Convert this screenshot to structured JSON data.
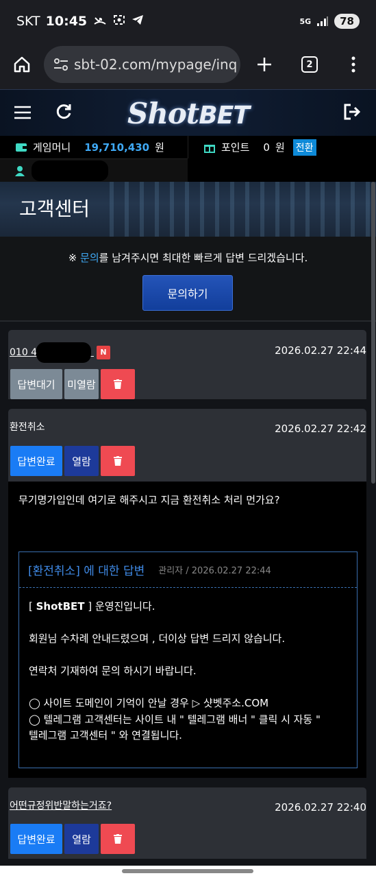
{
  "status_bar": {
    "carrier": "SKT",
    "time": "10:45",
    "icons": [
      "missed-call-icon",
      "screenshot-icon",
      "telegram-icon"
    ],
    "right_icons": [
      "5g-icon",
      "signal-icon"
    ],
    "battery": "78"
  },
  "browser": {
    "url": "sbt-02.com/mypage/inq",
    "tab_count": "2"
  },
  "site": {
    "logo_shot": "Shot",
    "logo_bet": "BET"
  },
  "account": {
    "money_label": "게임머니",
    "money_value": "19,710,430",
    "money_unit": "원",
    "point_label": "포인트",
    "point_value": "0",
    "point_unit": "원",
    "convert_label": "전환"
  },
  "banner": {
    "title": "고객센터"
  },
  "notice": {
    "prefix": "※ ",
    "highlight": "문의",
    "suffix": "를 남겨주시면 최대한 빠르게 답변 드리겠습니다.",
    "ask_button": "문의하기"
  },
  "inquiries": [
    {
      "subject": "010 4",
      "badge": "N",
      "date": "2026.02.27 22:44",
      "status": "답변대기",
      "read": "미열람"
    },
    {
      "subject": "환전취소",
      "date": "2026.02.27 22:42",
      "status": "답변완료",
      "read": "열람",
      "question": "무기명가입인데 여기로 해주시고 지금 환전취소 처리 먼가요?",
      "answer": {
        "title": "[환전취소] 에 대한 답변",
        "meta": "관리자 / 2026.02.27 22:44",
        "line1_prefix": "[ ",
        "line1_brand": "ShotBET",
        "line1_suffix": " ] 운영진입니다.",
        "line2": "회원님 수차례 안내드렸으며 , 더이상 답변 드리지 않습니다.",
        "line3": "연락처 기재하여 문의 하시기 바랍니다.",
        "line4": "◯ 사이트 도메인이 기억이 안날 경우 ▷ 샷벳주소.COM",
        "line5": "◯ 텔레그램 고객센터는 사이트 내 \" 텔레그램 배너 \" 클릭 시 자동 \"",
        "line6": "텔레그램 고객센터 \" 와 연결됩니다."
      }
    },
    {
      "subject": "어떤규정위반말하는거죠?",
      "date": "2026.02.27 22:40",
      "status": "답변완료",
      "read": "열람"
    }
  ]
}
